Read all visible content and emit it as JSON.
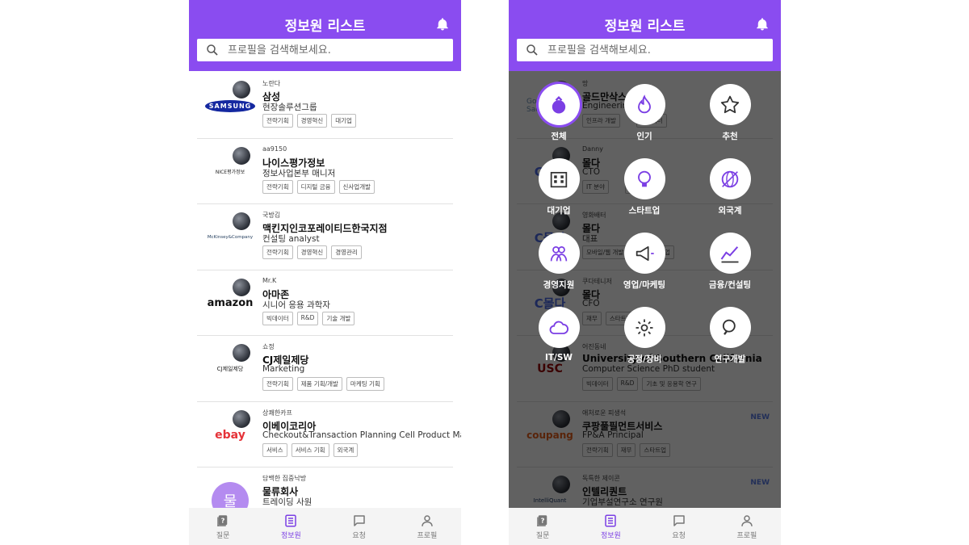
{
  "app": {
    "title": "정보원 리스트",
    "search_placeholder": "프로필을 검색해보세요.",
    "accent_color": "#8a4cf0",
    "new_badge_color": "#5b7de8"
  },
  "left_list": [
    {
      "nickname": "노란다",
      "company": "삼성",
      "role": "현장솔루션그룹",
      "tags": [
        "전략기획",
        "경영혁신",
        "대기업"
      ],
      "logo": "SAMSUNG"
    },
    {
      "nickname": "aa9150",
      "company": "나이스평가정보",
      "role": "정보사업본부 매니저",
      "tags": [
        "전략기획",
        "디지털 금융",
        "신사업개발"
      ],
      "logo": "NICE평가정보"
    },
    {
      "nickname": "국방김",
      "company": "맥킨지인코포레이티드한국지점",
      "role": "컨설팅 analyst",
      "tags": [
        "전략기획",
        "경영혁신",
        "경영관리"
      ],
      "logo": "McKinsey&Company"
    },
    {
      "nickname": "Mr.K",
      "company": "아마존",
      "role": "시니어 응용 과학자",
      "tags": [
        "빅데이터",
        "R&D",
        "기술 개발"
      ],
      "logo": "amazon"
    },
    {
      "nickname": "쇼정",
      "company": "CJ제일제당",
      "role": "Marketing",
      "tags": [
        "전략기획",
        "제품 기획/개발",
        "마케팅 기획"
      ],
      "logo": "CJ제일제당"
    },
    {
      "nickname": "상쾌한카프",
      "company": "이베이코리아",
      "role": "Checkout&Transaction Planning Cell Product Manager",
      "tags": [
        "서비스",
        "서비스 기획",
        "외국계"
      ],
      "logo": "ebay"
    },
    {
      "nickname": "담백한 집중낙방",
      "company": "물류회사",
      "role": "트레이딩 사원",
      "tags": [],
      "logo": "물"
    }
  ],
  "right_list": [
    {
      "nickname": "망",
      "company": "골드만삭스",
      "role": "Engineering",
      "tags": [
        "인프라 개발",
        "",
        "빅데이터"
      ],
      "logo": "Goldman Sachs",
      "new": ""
    },
    {
      "nickname": "Danny",
      "company": "몰다",
      "role": "CTO",
      "tags": [
        "IT 분야",
        "",
        "스타트업"
      ],
      "logo": "C몰다",
      "new": ""
    },
    {
      "nickname": "영화배터",
      "company": "몰다",
      "role": "대표",
      "tags": [
        "모바일/웹 개발",
        "",
        "스타트업"
      ],
      "logo": "C몰다",
      "new": ""
    },
    {
      "nickname": "쿠다테니저",
      "company": "몰다",
      "role": "CFO",
      "tags": [
        "재무",
        "스타트업"
      ],
      "logo": "C몰다",
      "new": ""
    },
    {
      "nickname": "어진동네",
      "company": "University of Southern California",
      "role": "Computer Science PhD student",
      "tags": [
        "빅데이터",
        "R&D",
        "기초 및 응용학 연구"
      ],
      "logo": "USC",
      "new": ""
    },
    {
      "nickname": "애처로운 피생석",
      "company": "쿠팡풀필먼트서비스",
      "role": "FP&A Principal",
      "tags": [
        "전략기획",
        "재무",
        "스타트업"
      ],
      "logo": "coupang",
      "new": "NEW"
    },
    {
      "nickname": "독특한 제이콘",
      "company": "인텔리퀀트",
      "role": "기업부설연구소 연구원",
      "tags": [],
      "logo": "IntelliQuant",
      "new": "NEW"
    }
  ],
  "categories": [
    {
      "label": "전체",
      "icon": "pouch-icon",
      "selected": true
    },
    {
      "label": "인기",
      "icon": "flame-icon",
      "selected": false
    },
    {
      "label": "추천",
      "icon": "star-icon",
      "selected": false
    },
    {
      "label": "대기업",
      "icon": "building-icon",
      "selected": false
    },
    {
      "label": "스타트업",
      "icon": "bulb-icon",
      "selected": false
    },
    {
      "label": "외국계",
      "icon": "globe-icon",
      "selected": false
    },
    {
      "label": "경영지원",
      "icon": "people-icon",
      "selected": false
    },
    {
      "label": "영업/마케팅",
      "icon": "megaphone-icon",
      "selected": false
    },
    {
      "label": "금융/컨설팅",
      "icon": "chart-icon",
      "selected": false
    },
    {
      "label": "IT/SW",
      "icon": "cloud-icon",
      "selected": false
    },
    {
      "label": "공정/장비",
      "icon": "gear-icon",
      "selected": false
    },
    {
      "label": "연구개발",
      "icon": "magnifier-icon",
      "selected": false
    }
  ],
  "bottom_nav": [
    {
      "label": "질문",
      "icon": "question-icon",
      "active": false
    },
    {
      "label": "정보원",
      "icon": "list-icon",
      "active": true
    },
    {
      "label": "요청",
      "icon": "chat-icon",
      "active": false
    },
    {
      "label": "프로필",
      "icon": "person-icon",
      "active": false
    }
  ]
}
